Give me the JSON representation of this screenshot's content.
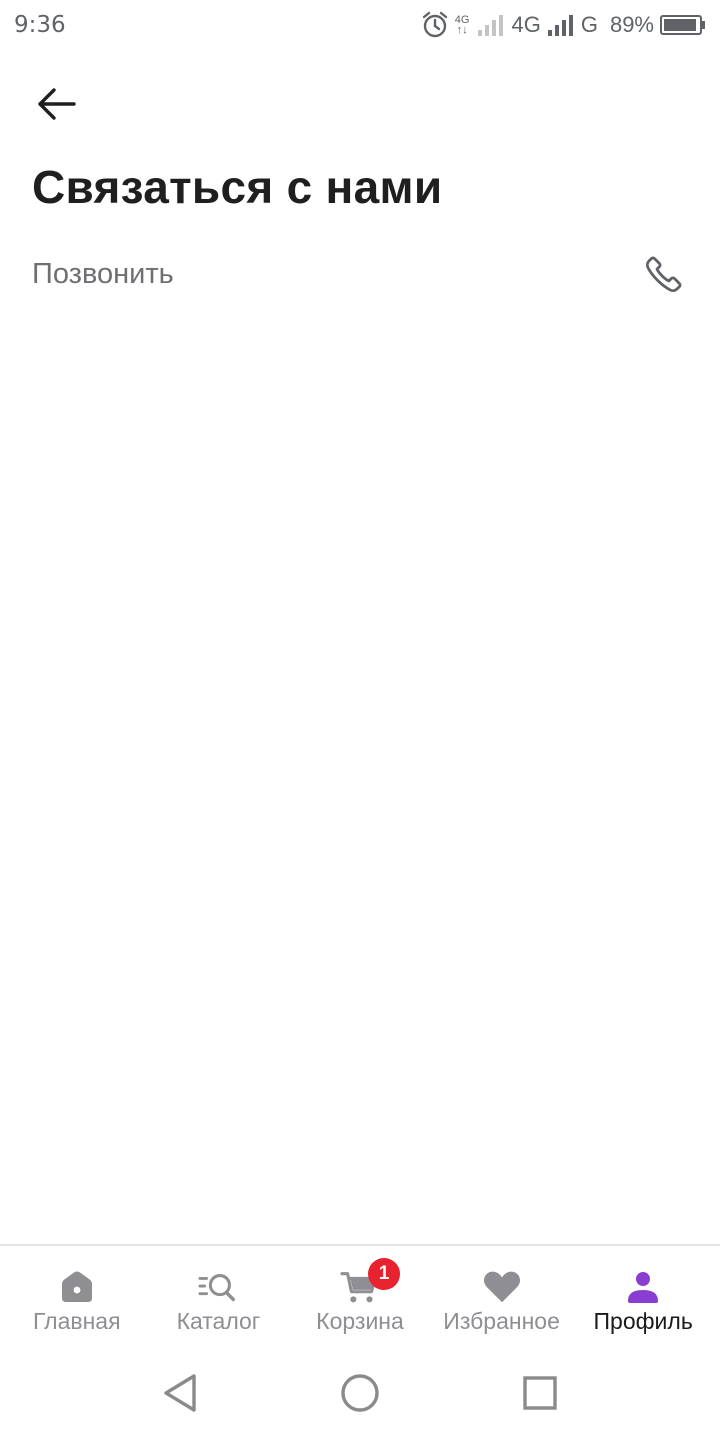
{
  "status_bar": {
    "time": "9:36",
    "net_small_top": "4G",
    "net_small_bottom": "↑↓",
    "network1": "4G",
    "network2": "G",
    "battery": "89%"
  },
  "header": {
    "back_icon": "arrow-left-icon",
    "title": "Связаться с нами"
  },
  "contact": {
    "call_label": "Позвонить",
    "call_icon": "phone-icon"
  },
  "bottom_nav": {
    "items": [
      {
        "label": "Главная",
        "icon": "home-icon"
      },
      {
        "label": "Каталог",
        "icon": "catalog-search-icon"
      },
      {
        "label": "Корзина",
        "icon": "cart-icon",
        "badge": "1"
      },
      {
        "label": "Избранное",
        "icon": "heart-icon"
      },
      {
        "label": "Профиль",
        "icon": "profile-icon",
        "active": true
      }
    ]
  },
  "colors": {
    "accent": "#8a3ed1",
    "inactive": "#8e8e93",
    "badge": "#e8232f",
    "title": "#1f1f1f"
  }
}
